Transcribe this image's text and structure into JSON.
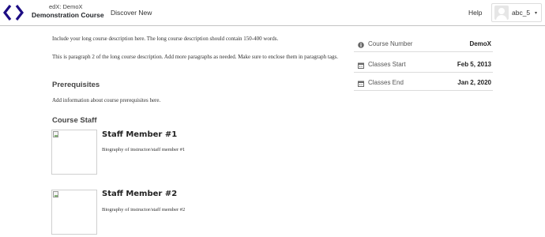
{
  "header": {
    "org_label": "edX: DemoX",
    "course_title": "Demonstration Course",
    "nav": {
      "discover": "Discover New",
      "help": "Help"
    },
    "user": {
      "username": "abc_5"
    }
  },
  "main": {
    "description_paragraphs": [
      "Include your long course description here. The long course description should contain 150-400 words.",
      "This is paragraph 2 of the long course description. Add more paragraphs as needed. Make sure to enclose them in paragraph tags."
    ],
    "prerequisites": {
      "title": "Prerequisites",
      "text": "Add information about course prerequisites here."
    },
    "staff": {
      "title": "Course Staff",
      "members": [
        {
          "name": "Staff Member #1",
          "bio": "Biography of instructor/staff member #1"
        },
        {
          "name": "Staff Member #2",
          "bio": "Biography of instructor/staff member #2"
        }
      ]
    }
  },
  "sidebar": {
    "items": [
      {
        "label": "Course Number",
        "value": "DemoX",
        "icon": "info-icon"
      },
      {
        "label": "Classes Start",
        "value": "Feb 5, 2013",
        "icon": "calendar-icon"
      },
      {
        "label": "Classes End",
        "value": "Jan 2, 2020",
        "icon": "calendar-icon"
      }
    ]
  },
  "colors": {
    "brand": "#1d0d84",
    "divider": "#dcdcdc",
    "text": "#313131"
  }
}
